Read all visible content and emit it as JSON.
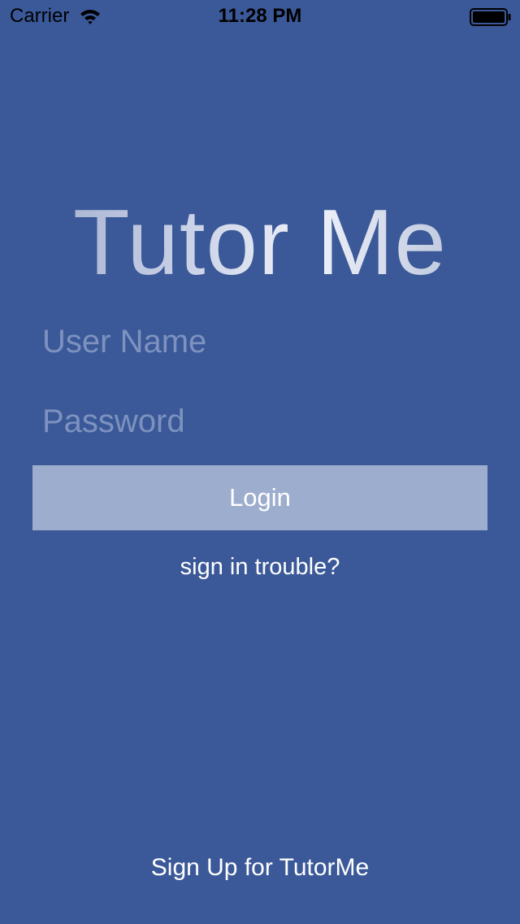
{
  "status_bar": {
    "carrier": "Carrier",
    "time": "11:28 PM",
    "wifi_icon": "wifi-icon",
    "battery_icon": "battery-icon"
  },
  "app": {
    "title": "Tutor Me"
  },
  "login_form": {
    "username_placeholder": "User Name",
    "username_value": "",
    "password_placeholder": "Password",
    "password_value": "",
    "login_label": "Login",
    "trouble_label": "sign in trouble?"
  },
  "footer": {
    "signup_label": "Sign Up for TutorMe"
  },
  "colors": {
    "background": "#3b5998",
    "button": "#9dadce",
    "placeholder": "#7d92bf",
    "text": "#ffffff"
  }
}
